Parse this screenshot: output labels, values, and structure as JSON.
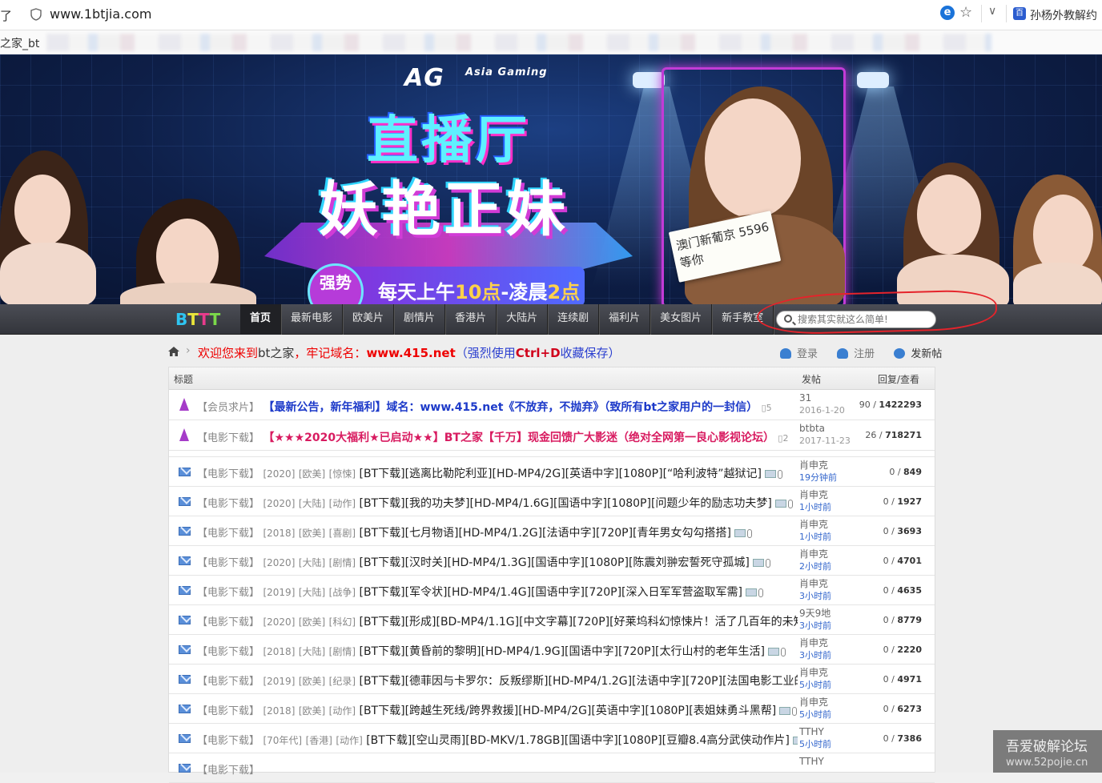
{
  "browser": {
    "left_fragment": "了",
    "url": "www.1btjia.com",
    "bookmark_label": "孙杨外教解约",
    "tab_fragment": "之家_bt"
  },
  "banner": {
    "brand": "AG",
    "brand_sub": "Asia Gaming",
    "headline1": "直播厅",
    "headline2": "妖艳正妹",
    "badge": "强势",
    "ribbon_pre": "每天上午",
    "ribbon_time1": "10点",
    "ribbon_mid": "-凌晨",
    "ribbon_time2": "2点",
    "sign_text": "澳门新葡京 5596等你"
  },
  "nav": {
    "logo": "BTTT",
    "items": [
      "首页",
      "最新电影",
      "欧美片",
      "剧情片",
      "香港片",
      "大陆片",
      "连续剧",
      "福利片",
      "美女图片",
      "新手教室"
    ],
    "search_placeholder": "搜索其实就这么简单!"
  },
  "crumb": {
    "welcome_a": "欢迎您来到",
    "site": "bt之家",
    "welcome_b": "，牢记域名：",
    "domain": "www.415.net",
    "hint_a": "（强烈使用",
    "hint_key": "Ctrl+D",
    "hint_b": "收藏保存）",
    "login": "登录",
    "register": "注册",
    "post": "发新帖"
  },
  "table": {
    "col_title": "标题",
    "col_author": "发帖",
    "col_stats": "回复/查看",
    "sticky": [
      {
        "cat": "【会员求片】",
        "title": "【最新公告，新年福利】域名：www.415.net《不放弃，不抛弃》（致所有bt之家用户的一封信）",
        "pages": "5",
        "author": "31",
        "time": "2016-1-20",
        "replies": "90",
        "views": "1422293",
        "style": "notice"
      },
      {
        "cat": "【电影下载】",
        "title": "【★★★2020大福利★已启动★★】BT之家【千万】现金回馈广大影迷（绝对全网第一良心影视论坛）",
        "pages": "2",
        "author": "btbta",
        "time": "2017-11-23",
        "replies": "26",
        "views": "718271",
        "style": "hot"
      }
    ],
    "rows": [
      {
        "cat": "【电影下载】",
        "year": "[2020]",
        "region": "[欧美]",
        "genre": "[惊悚]",
        "title": "[BT下载][逃离比勒陀利亚][HD-MP4/2G][英语中字][1080P][“哈利波特”越狱记]",
        "author": "肖申克",
        "time": "19分钟前",
        "replies": "0",
        "views": "849"
      },
      {
        "cat": "【电影下载】",
        "year": "[2020]",
        "region": "[大陆]",
        "genre": "[动作]",
        "title": "[BT下载][我的功夫梦][HD-MP4/1.6G][国语中字][1080P][问题少年的励志功夫梦]",
        "author": "肖申克",
        "time": "1小时前",
        "replies": "0",
        "views": "1927"
      },
      {
        "cat": "【电影下载】",
        "year": "[2018]",
        "region": "[欧美]",
        "genre": "[喜剧]",
        "title": "[BT下载][七月物语][HD-MP4/1.2G][法语中字][720P][青年男女勾勾搭搭]",
        "author": "肖申克",
        "time": "1小时前",
        "replies": "0",
        "views": "3693"
      },
      {
        "cat": "【电影下载】",
        "year": "[2020]",
        "region": "[大陆]",
        "genre": "[剧情]",
        "title": "[BT下载][汉时关][HD-MP4/1.3G][国语中字][1080P][陈震刘翀宏誓死守孤城]",
        "author": "肖申克",
        "time": "2小时前",
        "replies": "0",
        "views": "4701"
      },
      {
        "cat": "【电影下载】",
        "year": "[2019]",
        "region": "[大陆]",
        "genre": "[战争]",
        "title": "[BT下载][军令状][HD-MP4/1.4G][国语中字][720P][深入日军军营盗取军需]",
        "author": "肖申克",
        "time": "3小时前",
        "replies": "0",
        "views": "4635"
      },
      {
        "cat": "【电影下载】",
        "year": "[2020]",
        "region": "[欧美]",
        "genre": "[科幻]",
        "title": "[BT下载][形成][BD-MP4/1.1G][中文字幕][720P][好莱坞科幻惊悚片！活了几百年的未知生",
        "author": "9天9地",
        "time": "3小时前",
        "replies": "0",
        "views": "8779"
      },
      {
        "cat": "【电影下载】",
        "year": "[2018]",
        "region": "[大陆]",
        "genre": "[剧情]",
        "title": "[BT下载][黄昏前的黎明][HD-MP4/1.9G][国语中字][720P][太行山村的老年生活]",
        "author": "肖申克",
        "time": "3小时前",
        "replies": "0",
        "views": "2220"
      },
      {
        "cat": "【电影下载】",
        "year": "[2019]",
        "region": "[欧美]",
        "genre": "[纪录]",
        "title": "[BT下载][德菲因与卡罗尔：反叛缪斯][HD-MP4/1.2G][法语中字][720P][法国电影工业的女",
        "author": "肖申克",
        "time": "5小时前",
        "replies": "0",
        "views": "4971"
      },
      {
        "cat": "【电影下载】",
        "year": "[2018]",
        "region": "[欧美]",
        "genre": "[动作]",
        "title": "[BT下载][跨越生死线/跨界救援][HD-MP4/2G][英语中字][1080P][表姐妹勇斗黑帮]",
        "author": "肖申克",
        "time": "5小时前",
        "replies": "0",
        "views": "6273"
      },
      {
        "cat": "【电影下载】",
        "year": "[70年代]",
        "region": "[香港]",
        "genre": "[动作]",
        "title": "[BT下载][空山灵雨][BD-MKV/1.78GB][国语中字][1080P][豆瓣8.4高分武侠动作片]",
        "author": "TTHY",
        "time": "5小时前",
        "replies": "0",
        "views": "7386"
      },
      {
        "cat": "【电影下载】",
        "year": "",
        "region": "",
        "genre": "",
        "title": "",
        "author": "TTHY",
        "time": "",
        "replies": "",
        "views": ""
      }
    ]
  },
  "watermark": {
    "line1": "吾爱破解论坛",
    "line2": "www.52pojie.cn"
  }
}
